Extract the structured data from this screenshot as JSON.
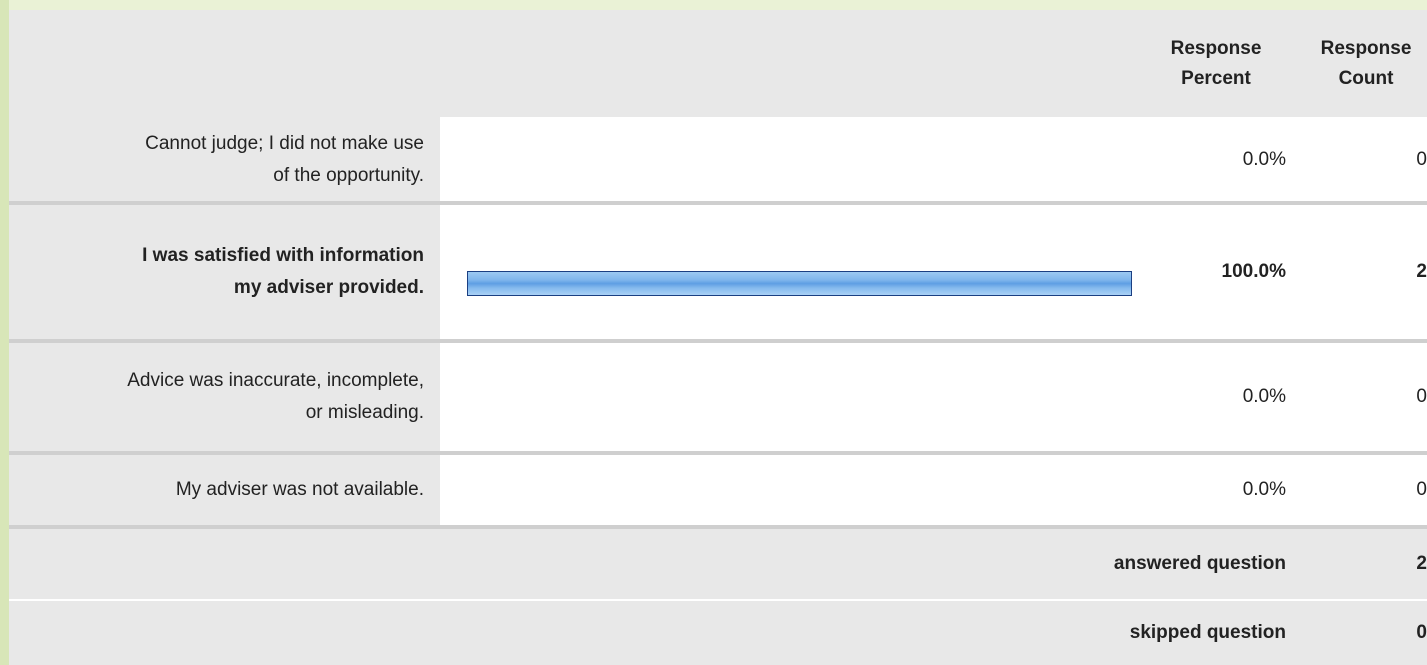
{
  "header": {
    "percent_label_line1": "Response",
    "percent_label_line2": "Percent",
    "count_label_line1": "Response",
    "count_label_line2": "Count"
  },
  "rows": [
    {
      "label_line1": "Cannot judge; I did not make use",
      "label_line2": "of the opportunity.",
      "percent": "0.0%",
      "percent_value": 0,
      "count": "0",
      "bold": false
    },
    {
      "label_line1": "I was satisfied with information",
      "label_line2": "my adviser provided.",
      "percent": "100.0%",
      "percent_value": 100,
      "count": "2",
      "bold": true
    },
    {
      "label_line1": "Advice was inaccurate, incomplete,",
      "label_line2": "or misleading.",
      "percent": "0.0%",
      "percent_value": 0,
      "count": "0",
      "bold": false
    },
    {
      "label_line1": "My adviser was not available.",
      "label_line2": "",
      "percent": "0.0%",
      "percent_value": 0,
      "count": "0",
      "bold": false
    }
  ],
  "footer": {
    "answered_label": "answered question",
    "answered_value": "2",
    "skipped_label": "skipped question",
    "skipped_value": "0"
  },
  "colors": {
    "bar_fill": "#7fb5ec",
    "bar_border": "#1b3f82",
    "panel_gray": "#e8e8e8",
    "accent_green": "#d8e6b8"
  }
}
